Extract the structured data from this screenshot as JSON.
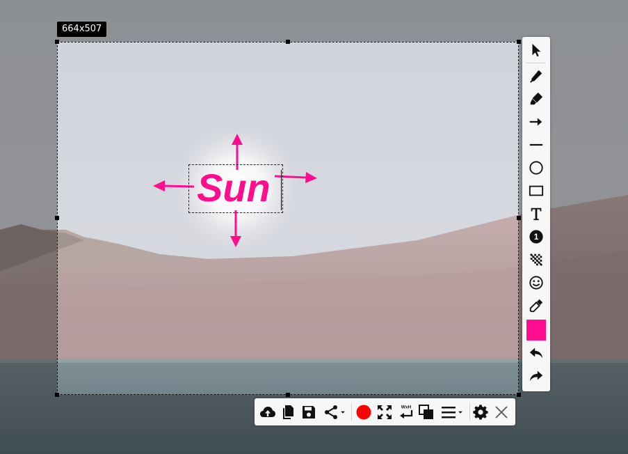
{
  "selection": {
    "size_label": "664x507"
  },
  "annotation": {
    "text": "Sun",
    "color": "#ff0d8f"
  },
  "toolbar_tools": [
    {
      "name": "select-tool",
      "icon": "cursor-arrow-icon"
    },
    {
      "name": "pen-tool",
      "icon": "pen-icon"
    },
    {
      "name": "marker-tool",
      "icon": "highlighter-icon"
    },
    {
      "name": "arrow-tool",
      "icon": "arrow-right-icon"
    },
    {
      "name": "line-tool",
      "icon": "line-icon"
    },
    {
      "name": "ellipse-tool",
      "icon": "circle-icon"
    },
    {
      "name": "rectangle-tool",
      "icon": "rectangle-icon"
    },
    {
      "name": "text-tool",
      "icon": "text-T-icon"
    },
    {
      "name": "counter-tool",
      "icon": "numbered-marker-icon",
      "label": "1"
    },
    {
      "name": "blur-tool",
      "icon": "pixelate-icon"
    },
    {
      "name": "emoji-tool",
      "icon": "smiley-icon"
    },
    {
      "name": "color-picker-tool",
      "icon": "eyedropper-icon"
    },
    {
      "name": "undo",
      "icon": "undo-icon"
    },
    {
      "name": "redo",
      "icon": "redo-icon"
    }
  ],
  "toolbar_actions": [
    {
      "name": "upload",
      "icon": "cloud-upload-icon"
    },
    {
      "name": "copy",
      "icon": "copy-icon"
    },
    {
      "name": "save",
      "icon": "floppy-disk-icon"
    },
    {
      "name": "share",
      "icon": "share-icon"
    },
    {
      "name": "record",
      "icon": "record-icon"
    },
    {
      "name": "fullscreen",
      "icon": "expand-icon"
    },
    {
      "name": "resize",
      "icon": "resize-wxh-icon",
      "label": "WxH"
    },
    {
      "name": "pin",
      "icon": "pin-copies-icon"
    },
    {
      "name": "menu",
      "icon": "hamburger-menu-icon"
    },
    {
      "name": "settings",
      "icon": "gear-icon"
    },
    {
      "name": "close",
      "icon": "close-icon"
    }
  ],
  "colors": {
    "active_color": "#ff0d8f",
    "record": "#ff0000"
  }
}
